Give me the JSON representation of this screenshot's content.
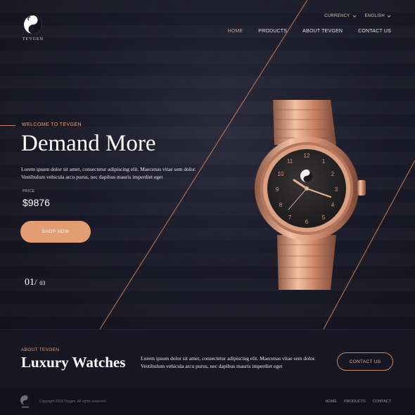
{
  "brand": {
    "name": "TEVGEN"
  },
  "utility": {
    "currency": "CURRENCY",
    "language": "ENGLISH"
  },
  "nav": [
    "HOME",
    "PRODUCTS",
    "ABOUT TEVGEN",
    "CONTACT US"
  ],
  "hero": {
    "eyebrow": "WELCOME TO TEVGEN",
    "headline": "Demand More",
    "description": "Lorem ipsum dolor sit amet, consectetur adipiscing elit. Maecenas vitae sem dolor. Vestibulum vehicula arcu purus, nec dapibus mauris imperdiet eget",
    "price_label": "PRICE",
    "price": "$9876",
    "cta": "SHOP NOW",
    "slide_current": "01",
    "slide_separator": "/",
    "slide_total": "03"
  },
  "about": {
    "eyebrow": "ABOUT TEVGEN",
    "title": "Luxury Watches",
    "text": "Lorem ipsum dolor sit amet, consectetur adipiscing elit. Maecenas vitae sem dolor. Vestibulum vehicula arcu purus, nec dapibus mauris imperdiet eget",
    "cta": "CONTACT US"
  },
  "footer": {
    "copyright": "Copyright 2018 Tevgen. All rights reserved.",
    "nav": [
      "HOME",
      "PRODUCTS",
      "CONTACT"
    ]
  },
  "colors": {
    "accent": "#e29e72",
    "background": "#141320",
    "rose_gold": "#d9977a"
  },
  "icons": {
    "logo": "yin-yang-swan-logo",
    "dropdown": "chevron-down-icon"
  }
}
